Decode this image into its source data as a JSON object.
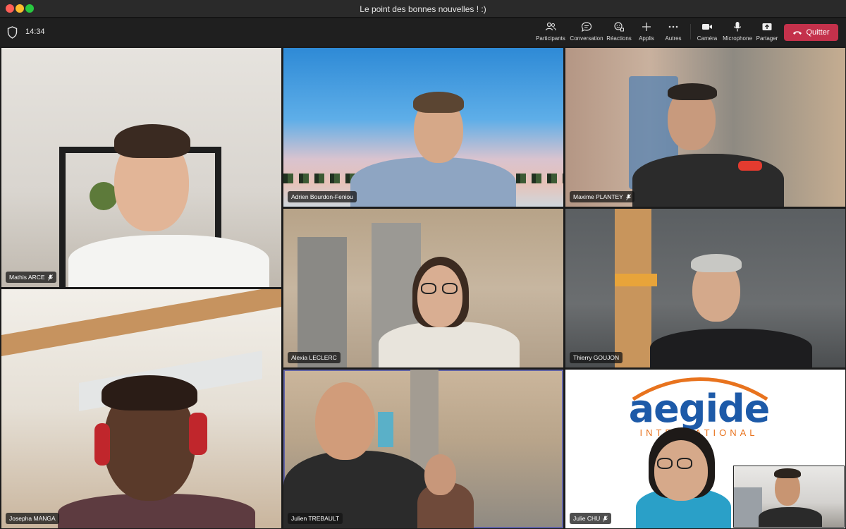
{
  "window": {
    "title": "Le point des bonnes nouvelles ! :)"
  },
  "toolbar": {
    "time": "14:34",
    "buttons": [
      {
        "label": "Participants",
        "icon": "people-icon"
      },
      {
        "label": "Conversation",
        "icon": "chat-icon"
      },
      {
        "label": "Réactions",
        "icon": "reactions-icon"
      },
      {
        "label": "Applis",
        "icon": "plus-icon"
      },
      {
        "label": "Autres",
        "icon": "more-icon"
      },
      {
        "label": "Caméra",
        "icon": "camera-icon"
      },
      {
        "label": "Microphone",
        "icon": "microphone-icon"
      },
      {
        "label": "Partager",
        "icon": "share-icon"
      }
    ],
    "leave_label": "Quitter",
    "leave_color": "#c4314b"
  },
  "participants": [
    {
      "name": "Mathis ARCE",
      "muted": true
    },
    {
      "name": "Adrien Bourdon-Feniou",
      "muted": false
    },
    {
      "name": "Maxime PLANTEY",
      "muted": true
    },
    {
      "name": "Alexia LECLERC",
      "muted": false
    },
    {
      "name": "Thierry GOUJON",
      "muted": false
    },
    {
      "name": "Josepha MANGA",
      "muted": false
    },
    {
      "name": "Julien TREBAULT",
      "muted": false
    },
    {
      "name": "Julie CHU",
      "muted": true
    }
  ],
  "background_logo": {
    "line1": "aegide",
    "line2": "INTERNATIONAL"
  },
  "active_speaker_color": "#6264a7"
}
